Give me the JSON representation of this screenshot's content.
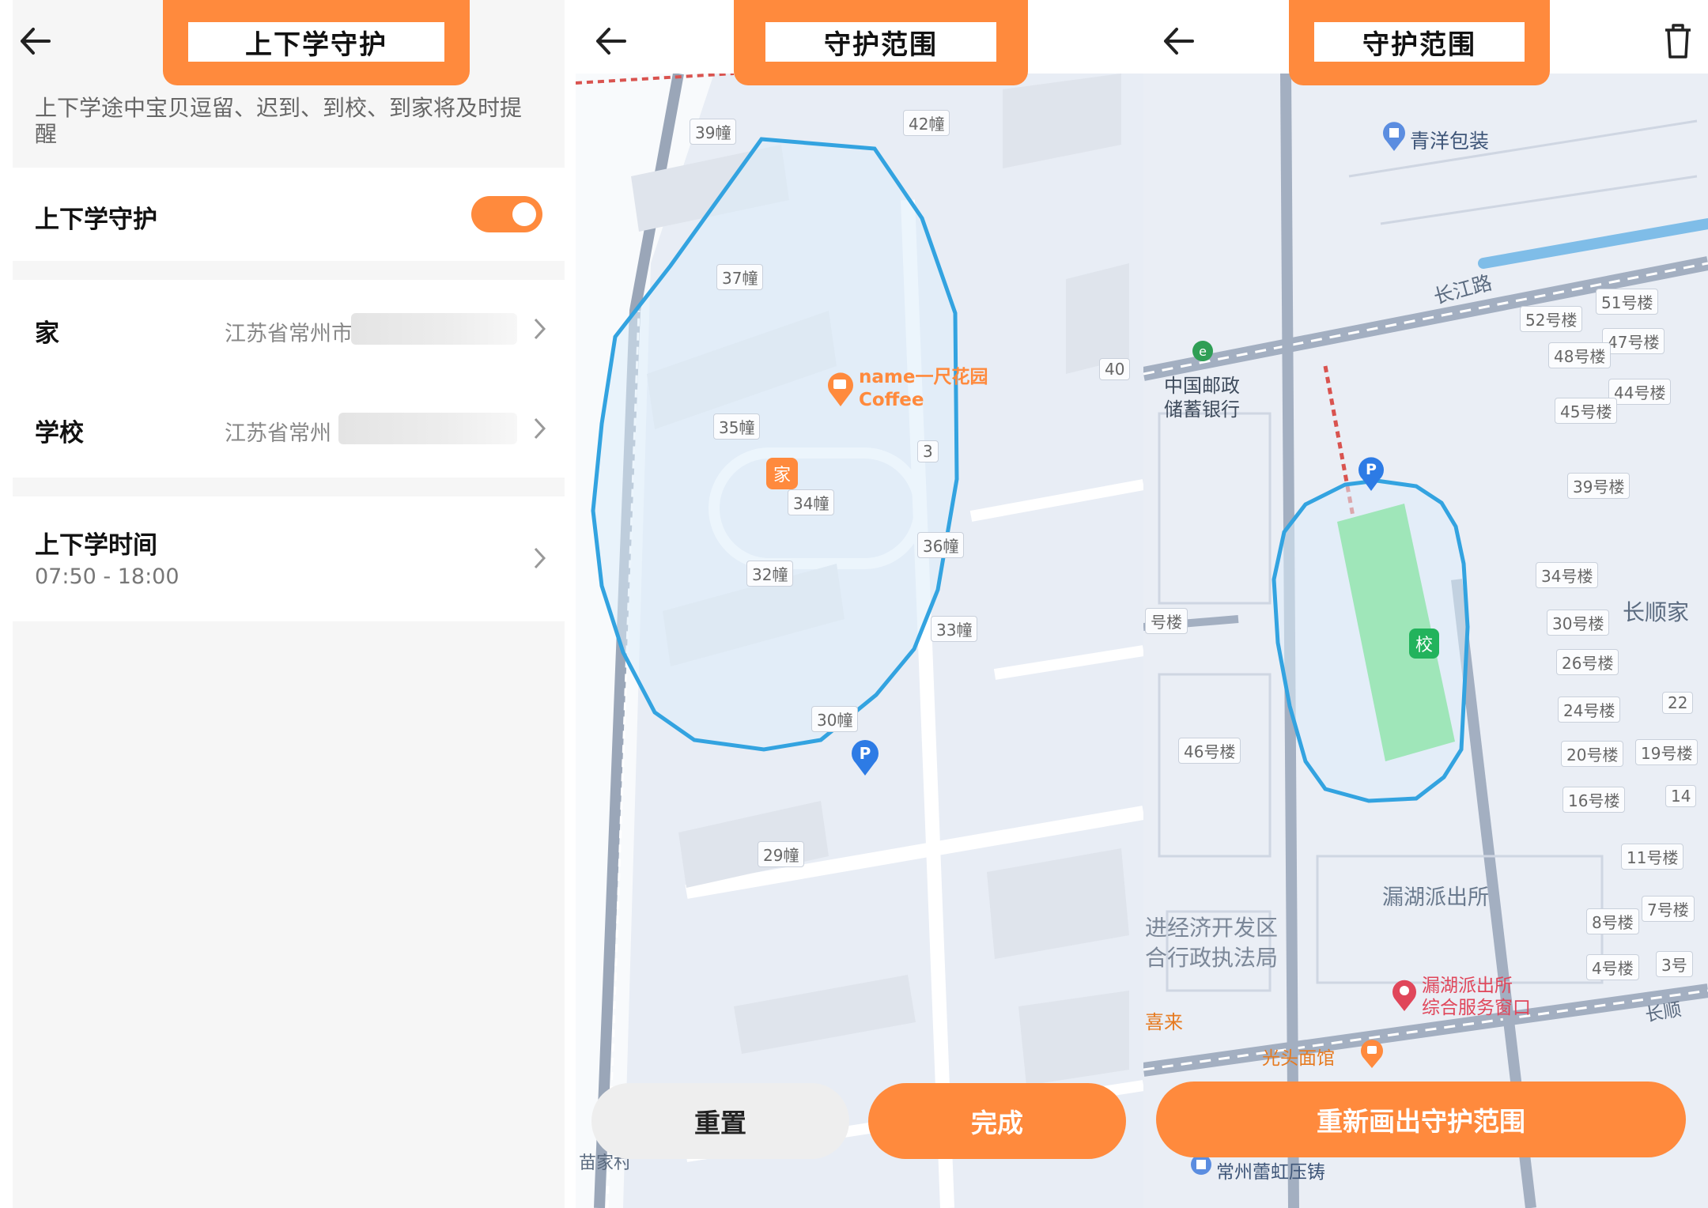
{
  "panel1": {
    "title": "上下学守护",
    "description": "上下学途中宝贝逗留、迟到、到校、到家将及时提醒",
    "guard": {
      "label": "上下学守护",
      "enabled": true
    },
    "home": {
      "label": "家",
      "address": "江苏省常州市"
    },
    "school": {
      "label": "学校",
      "address": "江苏省常州"
    },
    "schedule": {
      "label": "上下学时间",
      "value": "07:50 - 18:00"
    }
  },
  "panel2": {
    "title": "守护范围",
    "map_labels": [
      "39幢",
      "42幢",
      "37幢",
      "35幢",
      "34幢",
      "3",
      "40",
      "36幢",
      "32幢",
      "33幢",
      "30幢",
      "29幢"
    ],
    "poi_name": "name一尺花园",
    "poi_sub": "Coffee",
    "home_marker": "家",
    "village_text": "苗家村",
    "reset_button": "重置",
    "done_button": "完成",
    "colors": {
      "accent": "#ff8a3d",
      "fence": "#33a3e0"
    }
  },
  "panel3": {
    "title": "守护范围",
    "poi_top": "青洋包装",
    "road": "长江路",
    "bank": [
      "中国邮政",
      "储蓄银行"
    ],
    "buildings": [
      "51号楼",
      "52号楼",
      "47号楼",
      "48号楼",
      "44号楼",
      "45号楼",
      "39号楼",
      "34号楼",
      "30号楼",
      "26号楼",
      "24号楼",
      "22",
      "20号楼",
      "19号楼",
      "16号楼",
      "14",
      "11号楼",
      "7号楼",
      "8号楼",
      "4号楼",
      "3号",
      "46号楼",
      "号楼"
    ],
    "area_name": "长顺家",
    "school_marker": "校",
    "police": "漏湖派出所",
    "police_service": [
      "漏湖派出所",
      "综合服务窗口"
    ],
    "zone": [
      "进经济开发区",
      "合行政执法局"
    ],
    "restaurant": "光头面馆",
    "road2": "长顺",
    "xi_lai": "喜来",
    "bottom_poi": "常州蕾虹压铸",
    "redraw_button": "重新画出守护范围",
    "colors": {
      "accent": "#ff8a3d",
      "fence": "#33a3e0",
      "school_fill": "#9fe6b9"
    }
  }
}
